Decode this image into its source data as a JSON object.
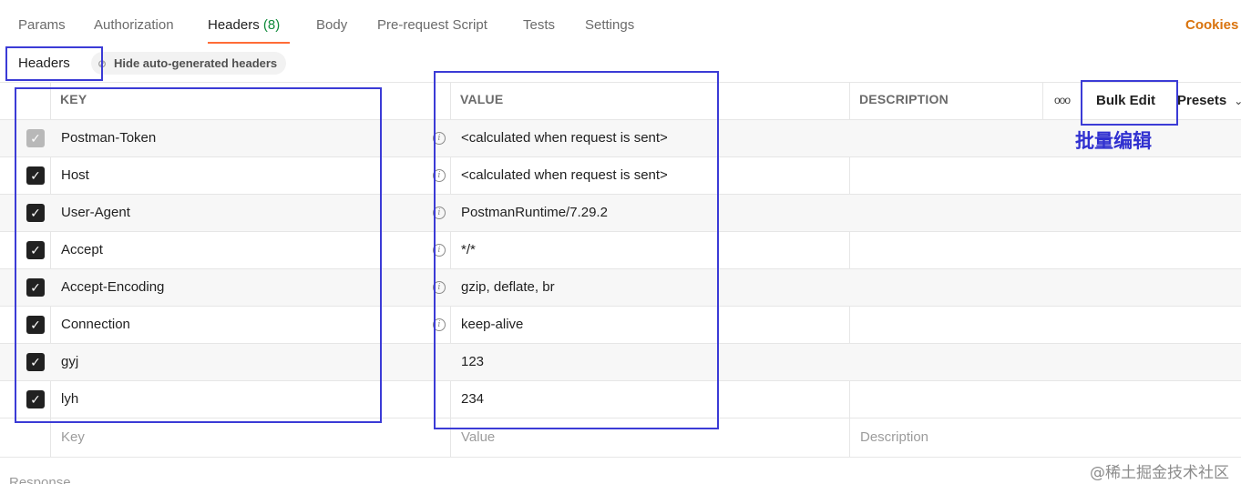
{
  "tabs": [
    {
      "label": "Params"
    },
    {
      "label": "Authorization"
    },
    {
      "label": "Headers",
      "count": "(8)"
    },
    {
      "label": "Body"
    },
    {
      "label": "Pre-request Script"
    },
    {
      "label": "Tests"
    },
    {
      "label": "Settings"
    }
  ],
  "cookies_label": "Cookies",
  "subheader": {
    "title": "Headers",
    "hide_auto_label": "Hide auto-generated headers"
  },
  "columns": {
    "key": "KEY",
    "value": "VALUE",
    "description": "DESCRIPTION"
  },
  "toolbar": {
    "bulk_edit_label": "Bulk Edit",
    "presets_label": "Presets"
  },
  "rows": [
    {
      "checked": true,
      "disabled": true,
      "key": "Postman-Token",
      "value": "<calculated when request is sent>",
      "info": true
    },
    {
      "checked": true,
      "disabled": false,
      "key": "Host",
      "value": "<calculated when request is sent>",
      "info": true
    },
    {
      "checked": true,
      "disabled": false,
      "key": "User-Agent",
      "value": "PostmanRuntime/7.29.2",
      "info": true
    },
    {
      "checked": true,
      "disabled": false,
      "key": "Accept",
      "value": "*/*",
      "info": true
    },
    {
      "checked": true,
      "disabled": false,
      "key": "Accept-Encoding",
      "value": "gzip, deflate, br",
      "info": true
    },
    {
      "checked": true,
      "disabled": false,
      "key": "Connection",
      "value": "keep-alive",
      "info": true
    },
    {
      "checked": true,
      "disabled": false,
      "key": "gyj",
      "value": "123",
      "info": false
    },
    {
      "checked": true,
      "disabled": false,
      "key": "lyh",
      "value": "234",
      "info": false
    }
  ],
  "new_row": {
    "key_placeholder": "Key",
    "value_placeholder": "Value",
    "description_placeholder": "Description"
  },
  "annotation_text": "批量编辑",
  "response_label": "Response",
  "watermark": "@稀土掘金技术社区",
  "colors": {
    "accent": "#ff6c37",
    "cookies": "#d9730d",
    "annotation": "#3b3bd6",
    "count": "#0f8a3a"
  }
}
